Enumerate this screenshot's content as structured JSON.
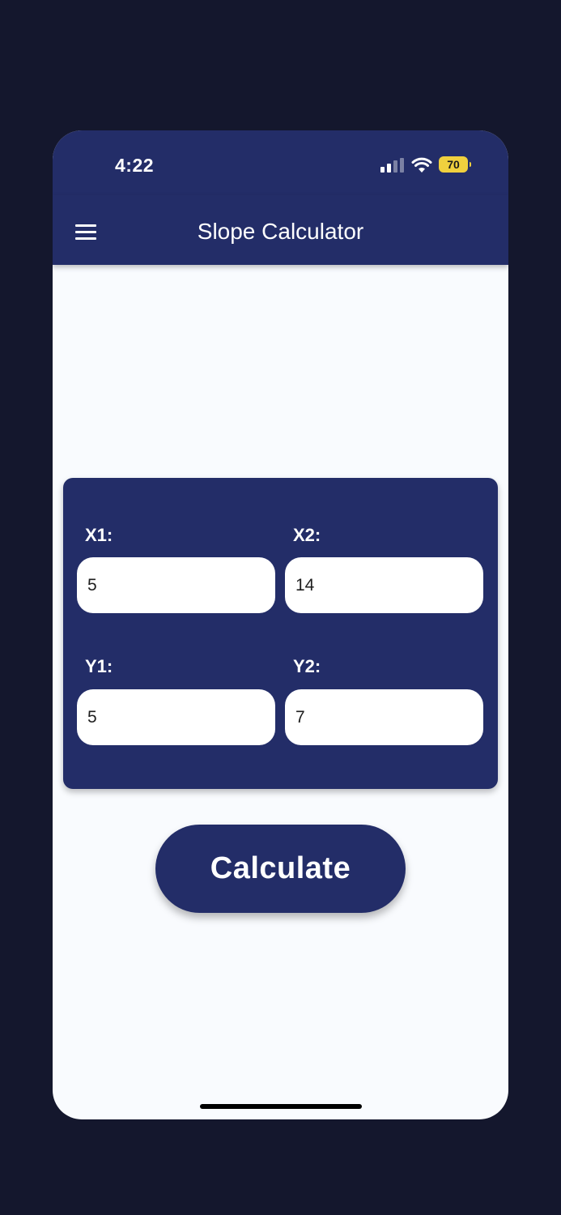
{
  "status_bar": {
    "time": "4:22",
    "battery": "70",
    "icons": [
      "signal-icon",
      "wifi-icon",
      "battery-icon"
    ]
  },
  "app_bar": {
    "title": "Slope Calculator",
    "menu_icon": "hamburger-menu-icon"
  },
  "form": {
    "x1": {
      "label": "X1:",
      "value": "5"
    },
    "x2": {
      "label": "X2:",
      "value": "14"
    },
    "y1": {
      "label": "Y1:",
      "value": "5"
    },
    "y2": {
      "label": "Y2:",
      "value": "7"
    }
  },
  "actions": {
    "calculate_label": "Calculate"
  },
  "colors": {
    "primary": "#232d68",
    "background": "#14172d",
    "surface": "#f9fbfe",
    "battery": "#f0d03e"
  }
}
